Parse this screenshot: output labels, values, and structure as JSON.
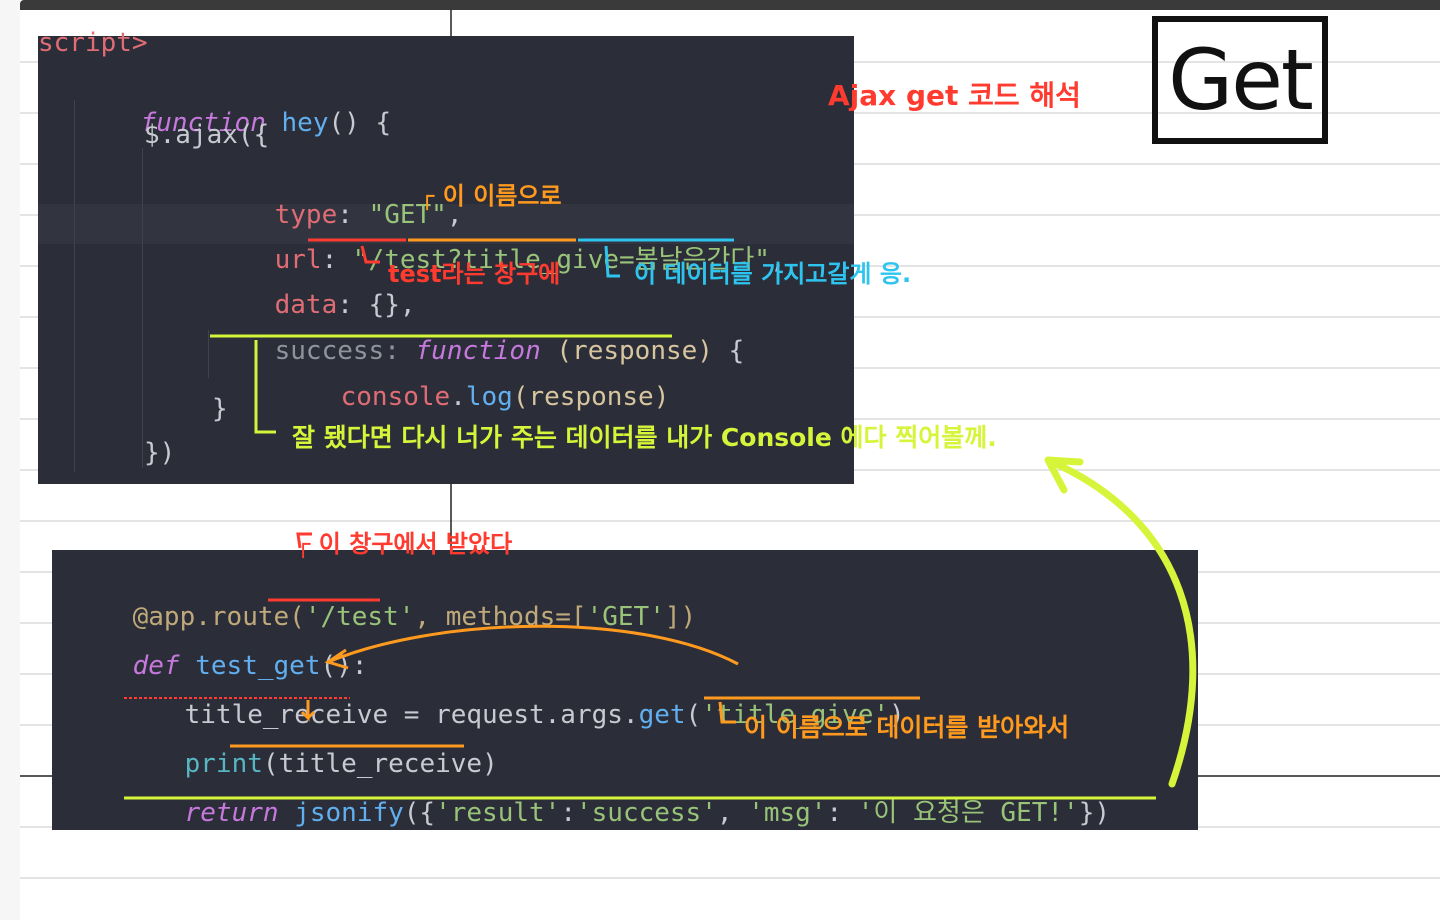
{
  "badge": "Get",
  "title_note": "Ajax get 코드 해석",
  "js_code": {
    "tag_fragment": "script>",
    "line1": {
      "kw": "function",
      "name": "hey",
      "rest": "() {"
    },
    "line2": "$.ajax({",
    "line3": {
      "key": "type",
      "value": "\"GET\"",
      "tail": ","
    },
    "line4": {
      "key": "url",
      "value_path": "\"/test?",
      "value_param": "title_give",
      "value_eq": "=",
      "value_data": "봄날은간다",
      "value_end": "\"",
      "tail": ","
    },
    "line5": {
      "key": "data",
      "value": "{}",
      "tail": ","
    },
    "line6": {
      "key": "success",
      "kw": "function",
      "args": "(response)",
      "tail": " {"
    },
    "line7": {
      "obj": "console",
      "method": "log",
      "args": "(response)"
    },
    "line8": "}",
    "line9": "})"
  },
  "py_code": {
    "line1": {
      "decorator": "@app.route(",
      "route": "'/test'",
      "mid": ", methods=[",
      "method": "'GET'",
      "end": "])"
    },
    "line2": {
      "kw": "def",
      "name": "test_get",
      "rest": "():"
    },
    "line3": {
      "var": "title_receive",
      "op": " = request.args.",
      "fn": "get",
      "open": "(",
      "arg": "'title_give'",
      "close": ")"
    },
    "line4": {
      "fn": "print",
      "open": "(",
      "arg": "title_receive",
      "close": ")"
    },
    "line5": {
      "kw": "return",
      "fn": "jsonify",
      "open": "({",
      "k1": "'result'",
      "c1": ":",
      "v1": "'success'",
      "sep": ", ",
      "k2": "'msg'",
      "c2": ": ",
      "v2": "'이 요청은 GET!'",
      "close": "})"
    }
  },
  "annotations": {
    "name_note": "┌ 이 이름으로",
    "window_note": "test라는 창구에",
    "data_note": "이 데이터를 가지고갈게 응.",
    "success_note": "잘 됐다면 다시 너가 주는 데이터를 내가 Console 에다 찍어볼께.",
    "received_note": "┌ 이 창구에서 받았다",
    "name_data_note": "이 이름으로 데이터를 받아와서"
  },
  "colors": {
    "red": "#ff3b30",
    "orange": "#ff9a1f",
    "blue": "#2ec4f0",
    "lime": "#d6f53a"
  }
}
